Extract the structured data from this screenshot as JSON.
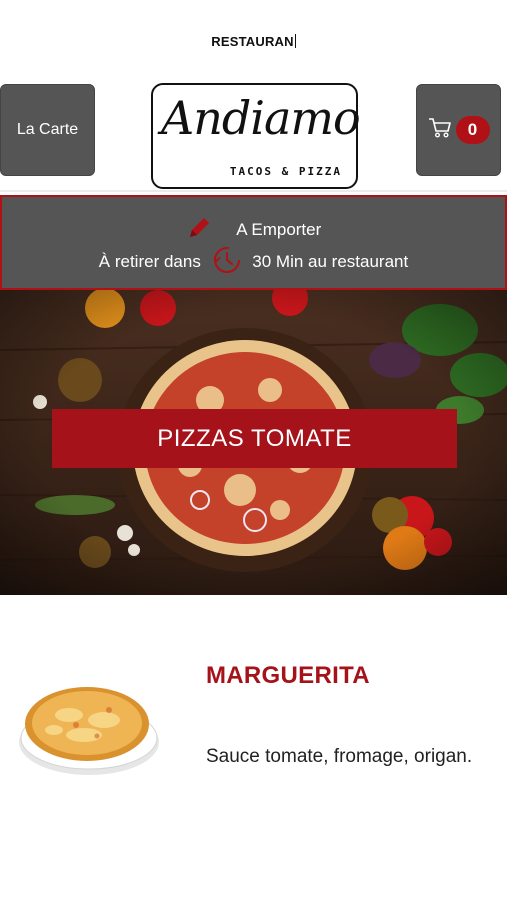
{
  "header": {
    "title": "RESTAURAN",
    "menu_button_label": "La Carte",
    "logo": {
      "name": "Andiamo",
      "tagline": "TACOS & PIZZA"
    },
    "cart": {
      "icon": "cart-icon",
      "count": "0"
    }
  },
  "order_info": {
    "mode_icon": "pencil-icon",
    "mode_label": "A Emporter",
    "pickup_prefix": "À retirer dans",
    "pickup_icon": "clock-icon",
    "pickup_time": "30 Min au restaurant"
  },
  "category": {
    "title": "PIZZAS TOMATE"
  },
  "products": [
    {
      "name": "MARGUERITA",
      "description": "Sauce tomate, fromage, origan."
    }
  ],
  "colors": {
    "accent": "#a5121a",
    "panel": "#555555",
    "background": "#ffffff"
  }
}
